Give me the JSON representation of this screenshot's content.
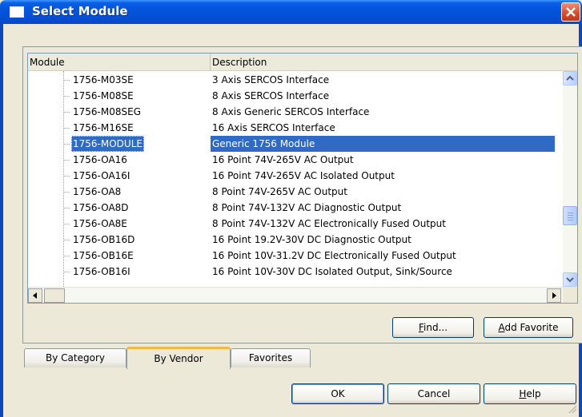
{
  "window": {
    "title": "Select Module",
    "close_label": "×"
  },
  "list": {
    "columns": [
      "Module",
      "Description"
    ],
    "rows": [
      {
        "module": "1756-M03SE",
        "description": "3 Axis SERCOS Interface",
        "selected": false
      },
      {
        "module": "1756-M08SE",
        "description": "8 Axis SERCOS Interface",
        "selected": false
      },
      {
        "module": "1756-M08SEG",
        "description": "8 Axis Generic SERCOS Interface",
        "selected": false
      },
      {
        "module": "1756-M16SE",
        "description": "16 Axis SERCOS Interface",
        "selected": false
      },
      {
        "module": "1756-MODULE",
        "description": "Generic 1756 Module",
        "selected": true
      },
      {
        "module": "1756-OA16",
        "description": "16 Point 74V-265V AC Output",
        "selected": false
      },
      {
        "module": "1756-OA16I",
        "description": "16 Point 74V-265V AC Isolated Output",
        "selected": false
      },
      {
        "module": "1756-OA8",
        "description": "8 Point 74V-265V AC Output",
        "selected": false
      },
      {
        "module": "1756-OA8D",
        "description": "8 Point 74V-132V AC Diagnostic Output",
        "selected": false
      },
      {
        "module": "1756-OA8E",
        "description": "8 Point 74V-132V AC Electronically Fused Output",
        "selected": false
      },
      {
        "module": "1756-OB16D",
        "description": "16 Point 19.2V-30V DC Diagnostic Output",
        "selected": false
      },
      {
        "module": "1756-OB16E",
        "description": "16 Point 10V-31.2V DC Electronically Fused Output",
        "selected": false
      },
      {
        "module": "1756-OB16I",
        "description": "16 Point 10V-30V DC Isolated Output, Sink/Source",
        "selected": false
      }
    ],
    "vertical_scroll_fraction": 0.72
  },
  "buttons": {
    "find": {
      "mnemonic": "F",
      "rest": "ind..."
    },
    "add_favorite": {
      "mnemonic": "A",
      "rest": "dd Favorite"
    },
    "ok": "OK",
    "cancel": "Cancel",
    "help": {
      "mnemonic": "H",
      "rest": "elp"
    }
  },
  "tabs": [
    {
      "label": "By Category",
      "active": false
    },
    {
      "label": "By Vendor",
      "active": true
    },
    {
      "label": "Favorites",
      "active": false
    }
  ],
  "colors": {
    "titlebar": "#0454dc",
    "selection": "#316ac5",
    "close_button": "#d94a2a",
    "active_tab_accent": "#f4b740"
  }
}
